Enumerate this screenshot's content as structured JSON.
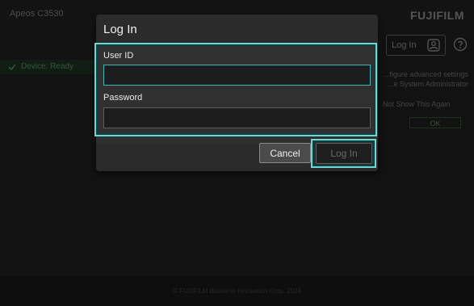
{
  "background": {
    "app_title": "Apeos C3530",
    "brand": "FUJIFILM",
    "header_login_label": "Log In",
    "status_text": "Device: Ready",
    "notice_text": "...figure advanced settings ...e System Administrator",
    "dont_show_text": "Not Show This Again",
    "ok_label": "OK",
    "copyright": "© FUJIFILM Business Innovation Corp. 2024"
  },
  "dialog": {
    "title": "Log In",
    "user_id_label": "User ID",
    "user_id_value": "",
    "password_label": "Password",
    "password_value": "",
    "cancel_label": "Cancel",
    "login_label": "Log In"
  },
  "colors": {
    "focus_ring": "#6fd6d6",
    "dialog_bg": "#2b2b2b",
    "status_green": "#5e9b6a"
  },
  "icons": [
    "user-icon",
    "help-icon",
    "check-icon"
  ]
}
